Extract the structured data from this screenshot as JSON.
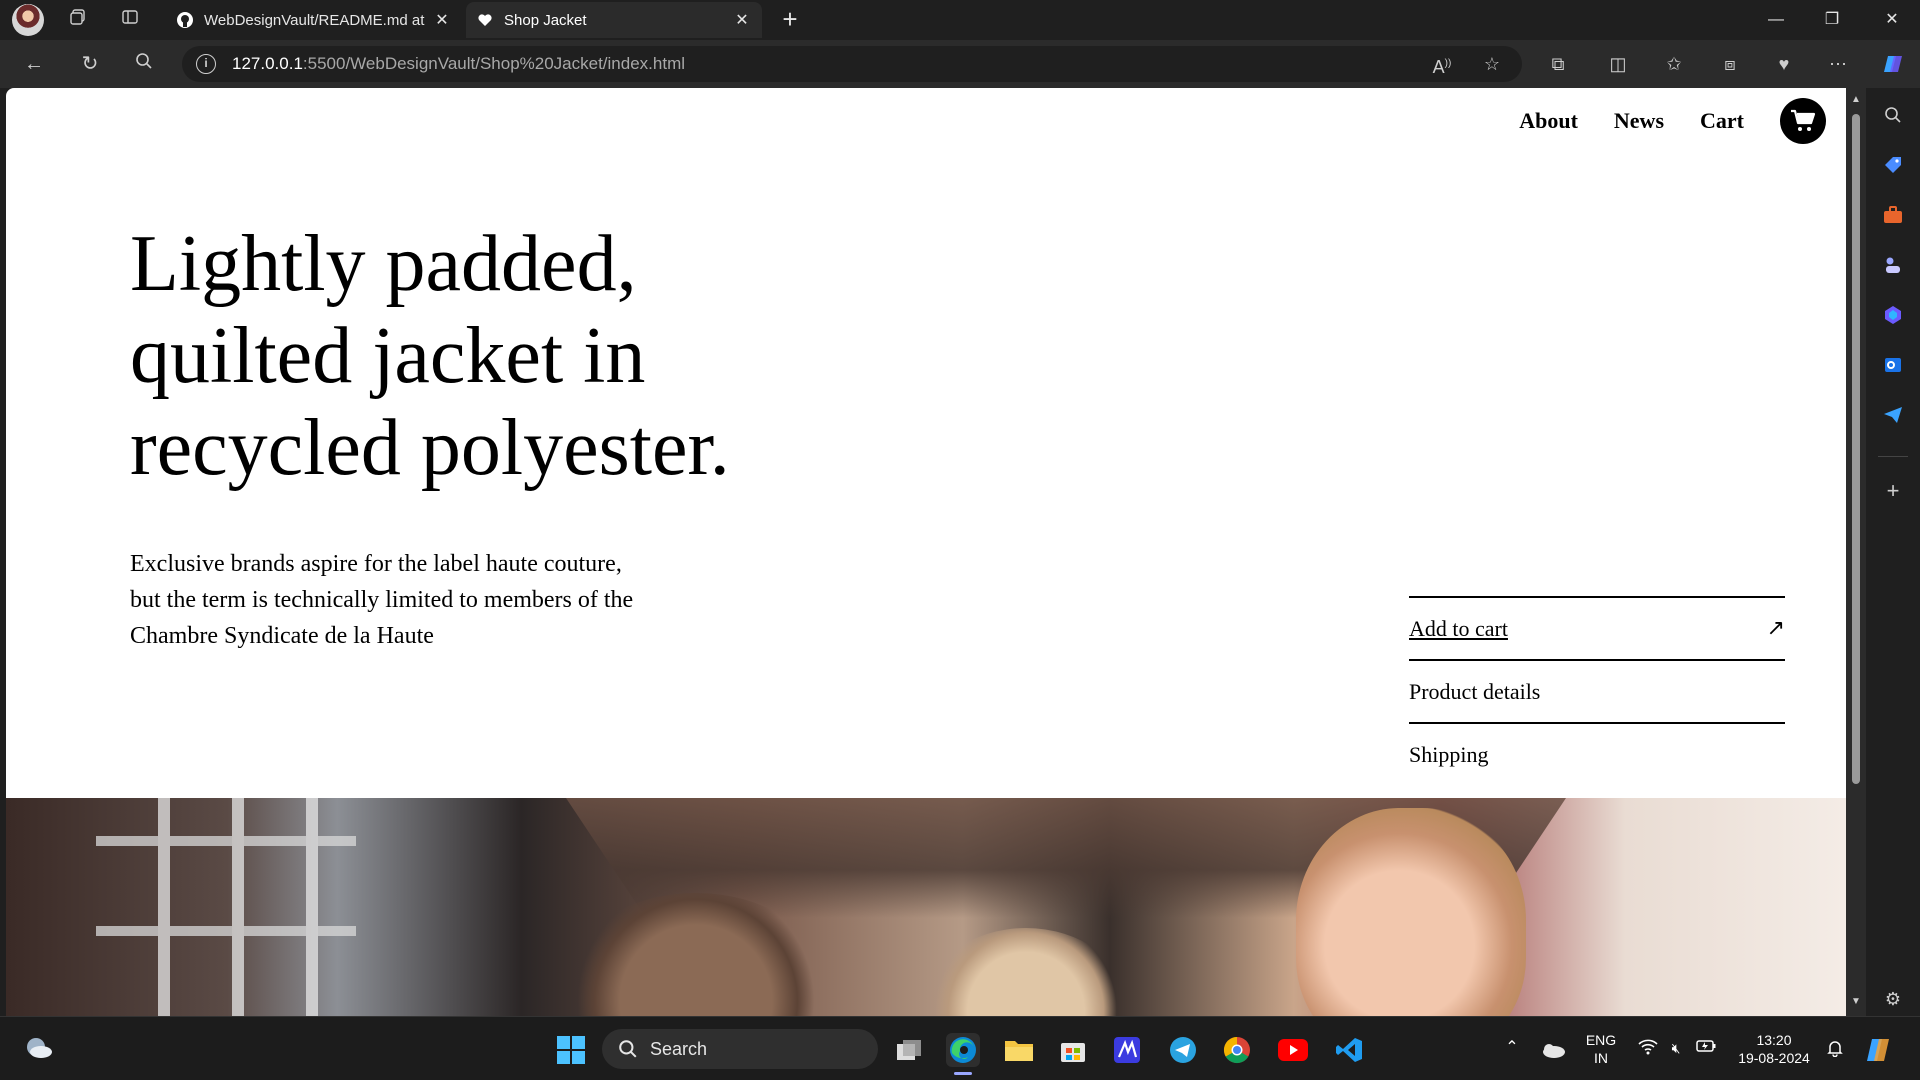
{
  "browser": {
    "tabs": [
      {
        "title": "WebDesignVault/README.md at",
        "favicon": "github-icon"
      },
      {
        "title": "Shop Jacket",
        "favicon": "heart-icon"
      }
    ],
    "url_host": "127.0.0.1",
    "url_path": ":5500/WebDesignVault/Shop%20Jacket/index.html"
  },
  "site": {
    "nav": {
      "about": "About",
      "news": "News",
      "cart": "Cart"
    },
    "headline": "Lightly padded, quilted jacket in recycled polyester.",
    "lede": "Exclusive brands aspire for the label haute couture, but the term is technically limited to members of the Chambre Syndicate de la Haute",
    "product_menu": {
      "add_to_cart": "Add to cart",
      "arrow": "↗",
      "details": "Product details",
      "shipping": "Shipping"
    }
  },
  "taskbar": {
    "search_label": "Search",
    "language_line1": "ENG",
    "language_line2": "IN",
    "time": "13:20",
    "date": "19-08-2024"
  },
  "colors": {
    "accent": "#9aa7ff",
    "chrome_dark": "#1f1f1f",
    "chrome_mid": "#2b2b2b"
  }
}
